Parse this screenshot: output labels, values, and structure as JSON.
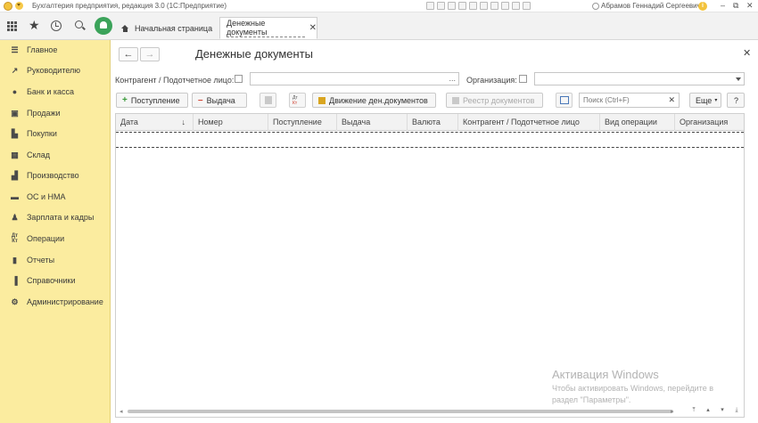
{
  "app": {
    "title": "Бухгалтерия предприятия, редакция 3.0 (1С:Предприятие)",
    "user": "Абрамов Геннадий Сергеевич",
    "accent_color": "#fbec9f",
    "notification_color": "#3ba35a"
  },
  "tabs": [
    {
      "label": "Начальная страница",
      "icon": "home-icon"
    },
    {
      "label": "Денежные документы",
      "active": true
    }
  ],
  "sidebar": {
    "items": [
      {
        "label": "Главное",
        "icon": "menu-lines-icon"
      },
      {
        "label": "Руководителю",
        "icon": "trend-icon"
      },
      {
        "label": "Банк и касса",
        "icon": "coin-icon"
      },
      {
        "label": "Продажи",
        "icon": "bag-icon"
      },
      {
        "label": "Покупки",
        "icon": "cart-icon"
      },
      {
        "label": "Склад",
        "icon": "warehouse-icon"
      },
      {
        "label": "Производство",
        "icon": "factory-icon"
      },
      {
        "label": "ОС и НМА",
        "icon": "truck-icon"
      },
      {
        "label": "Зарплата и кадры",
        "icon": "person-icon"
      },
      {
        "label": "Операции",
        "icon": "dt-kt-icon"
      },
      {
        "label": "Отчеты",
        "icon": "bar-chart-icon"
      },
      {
        "label": "Справочники",
        "icon": "book-icon"
      },
      {
        "label": "Администрирование",
        "icon": "gear-icon"
      }
    ]
  },
  "page": {
    "title": "Денежные документы",
    "filters": {
      "counterparty_label": "Контрагент / Подотчетное лицо:",
      "counterparty_value": "",
      "organization_label": "Организация:",
      "organization_value": ""
    },
    "buttons": {
      "receipt": "Поступление",
      "issue": "Выдача",
      "movement": "Движение ден.документов",
      "registry": "Реестр документов",
      "more": "Еще",
      "help": "?"
    },
    "search": {
      "placeholder": "Поиск (Ctrl+F)"
    },
    "table": {
      "columns": [
        "Дата",
        "Номер",
        "Поступление",
        "Выдача",
        "Валюта",
        "Контрагент / Подотчетное лицо",
        "Вид операции",
        "Организация"
      ]
    }
  },
  "watermark": {
    "title": "Активация Windows",
    "line1": "Чтобы активировать Windows, перейдите в",
    "line2": "раздел \"Параметры\"."
  }
}
